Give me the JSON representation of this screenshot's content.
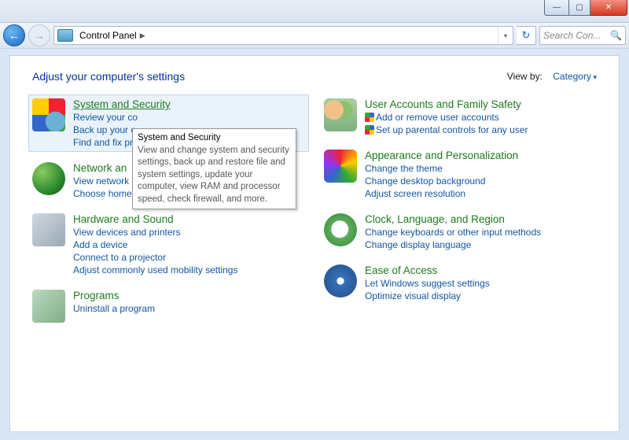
{
  "window": {
    "breadcrumb": "Control Panel",
    "search_placeholder": "Search Con..."
  },
  "header": {
    "title": "Adjust your computer's settings",
    "viewby_label": "View by:",
    "viewby_value": "Category"
  },
  "tooltip": {
    "title": "System and Security",
    "body": "View and change system and security settings, back up and restore file and system settings, update your computer, view RAM and processor speed, check firewall, and more."
  },
  "left": [
    {
      "title": "System and Security",
      "links": [
        "Review your co",
        "Back up your c",
        "Find and fix pro"
      ]
    },
    {
      "title": "Network an",
      "links": [
        "View network s",
        "Choose homegroup and sharing options"
      ]
    },
    {
      "title": "Hardware and Sound",
      "links": [
        "View devices and printers",
        "Add a device",
        "Connect to a projector",
        "Adjust commonly used mobility settings"
      ]
    },
    {
      "title": "Programs",
      "links": [
        "Uninstall a program"
      ]
    }
  ],
  "right": [
    {
      "title": "User Accounts and Family Safety",
      "links": [
        "Add or remove user accounts",
        "Set up parental controls for any user"
      ]
    },
    {
      "title": "Appearance and Personalization",
      "links": [
        "Change the theme",
        "Change desktop background",
        "Adjust screen resolution"
      ]
    },
    {
      "title": "Clock, Language, and Region",
      "links": [
        "Change keyboards or other input methods",
        "Change display language"
      ]
    },
    {
      "title": "Ease of Access",
      "links": [
        "Let Windows suggest settings",
        "Optimize visual display"
      ]
    }
  ]
}
